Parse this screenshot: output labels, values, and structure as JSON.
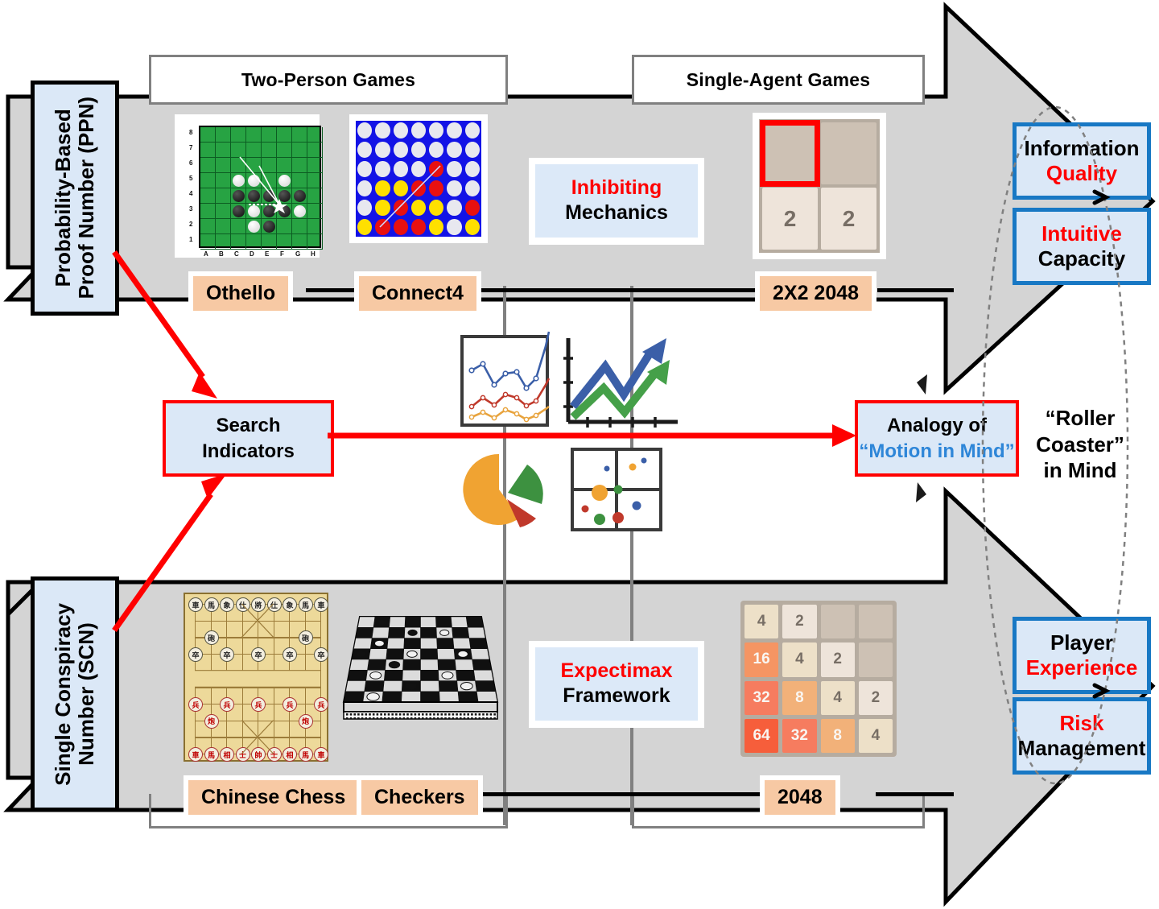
{
  "figure": {
    "categories": [
      {
        "label": "Two-Person Games"
      },
      {
        "label": "Single-Agent Games"
      }
    ],
    "left_labels": [
      {
        "label": "Probability-Based\nProof Number (PPN)"
      },
      {
        "label": "Single Conspiracy\nNumber (SCN)"
      }
    ],
    "game_chips_top": [
      {
        "label": "Othello"
      },
      {
        "label": "Connect4"
      },
      {
        "label": "2X2 2048"
      }
    ],
    "game_chips_bottom": [
      {
        "label": "Chinese Chess"
      },
      {
        "label": "Checkers"
      },
      {
        "label": "2048"
      }
    ],
    "concept_boxes": [
      {
        "line1": "Inhibiting",
        "line2": "Mechanics",
        "line1_color": "#ff0000",
        "line2_color": "#000000"
      },
      {
        "line1": "Expectimax",
        "line2": "Framework",
        "line1_color": "#ff0000",
        "line2_color": "#000000"
      }
    ],
    "search_indicators": {
      "line1": "Search",
      "line2": "Indicators"
    },
    "analogy": {
      "line1": "Analogy of",
      "line2": "“Motion in Mind”",
      "line2_color": "#2e86d8"
    },
    "roller_coaster": {
      "line1": "“Roller",
      "line2": "Coaster”",
      "line3": "in Mind"
    },
    "outcome_boxes": [
      {
        "line1": "Information",
        "line2": "Quality",
        "line1_color": "#000000",
        "line2_color": "#ff0000"
      },
      {
        "line1": "Intuitive",
        "line2": "Capacity",
        "line1_color": "#ff0000",
        "line2_color": "#000000"
      },
      {
        "line1": "Player",
        "line2": "Experience",
        "line1_color": "#000000",
        "line2_color": "#ff0000"
      },
      {
        "line1": "Risk",
        "line2": "Management",
        "line1_color": "#ff0000",
        "line2_color": "#000000"
      }
    ],
    "othello": {
      "col_labels": [
        "A",
        "B",
        "C",
        "D",
        "E",
        "F",
        "G",
        "H"
      ],
      "row_labels": [
        "8",
        "7",
        "6",
        "5",
        "4",
        "3",
        "2",
        "1"
      ],
      "white": [
        [
          2,
          5
        ],
        [
          3,
          5
        ],
        [
          5,
          5
        ],
        [
          3,
          3
        ],
        [
          6,
          3
        ],
        [
          3,
          2
        ]
      ],
      "black": [
        [
          2,
          4
        ],
        [
          3,
          4
        ],
        [
          4,
          4
        ],
        [
          5,
          4
        ],
        [
          6,
          4
        ],
        [
          2,
          3
        ],
        [
          4,
          3
        ],
        [
          5,
          3
        ],
        [
          4,
          2
        ]
      ]
    },
    "connect4": {
      "rows": 6,
      "cols": 7,
      "grid": [
        [
          "e",
          "e",
          "e",
          "e",
          "e",
          "e",
          "e"
        ],
        [
          "e",
          "e",
          "e",
          "e",
          "e",
          "e",
          "e"
        ],
        [
          "e",
          "e",
          "e",
          "e",
          "r",
          "e",
          "e"
        ],
        [
          "e",
          "y",
          "y",
          "r",
          "r",
          "e",
          "e"
        ],
        [
          "e",
          "y",
          "r",
          "y",
          "y",
          "e",
          "r"
        ],
        [
          "y",
          "r",
          "r",
          "r",
          "y",
          "e",
          "y"
        ]
      ]
    },
    "board2x2": {
      "cells": [
        "",
        "",
        "2",
        "2"
      ],
      "highlight_index": 0
    },
    "board2048": {
      "grid": [
        [
          "4",
          "2",
          "",
          ""
        ],
        [
          "16",
          "4",
          "2",
          ""
        ],
        [
          "32",
          "8",
          "4",
          "2"
        ],
        [
          "64",
          "32",
          "8",
          "4"
        ]
      ]
    },
    "tile_colors": {
      "2": {
        "bg": "#eee4da",
        "fg": "#776e65"
      },
      "4": {
        "bg": "#ede0c8",
        "fg": "#776e65"
      },
      "8": {
        "bg": "#f2b179",
        "fg": "#f9f6f2"
      },
      "16": {
        "bg": "#f59563",
        "fg": "#f9f6f2"
      },
      "32": {
        "bg": "#f67c5f",
        "fg": "#f9f6f2"
      },
      "64": {
        "bg": "#f65e3b",
        "fg": "#f9f6f2"
      },
      "": {
        "bg": "#cdc1b4",
        "fg": "#cdc1b4"
      }
    },
    "chinese_chess": {
      "black_back": [
        "車",
        "馬",
        "象",
        "仕",
        "將",
        "仕",
        "象",
        "馬",
        "車"
      ],
      "black_cannon": [
        "砲",
        "砲"
      ],
      "black_pawn": [
        "卒",
        "卒",
        "卒",
        "卒",
        "卒"
      ],
      "red_pawn": [
        "兵",
        "兵",
        "兵",
        "兵",
        "兵"
      ],
      "red_cannon": [
        "炮",
        "炮"
      ],
      "red_back": [
        "車",
        "馬",
        "相",
        "士",
        "帥",
        "士",
        "相",
        "馬",
        "車"
      ]
    },
    "colors": {
      "gray_arrow": "#d4d4d4",
      "chip": "#f7c9a4",
      "light_blue": "#dbe8f7",
      "blue_border": "#1878c4",
      "red": "#ff0000",
      "accent_blue": "#2e86d8"
    },
    "chart_icons": [
      {
        "name": "line-chart-icon",
        "series_colors": [
          "#3b5fa8",
          "#c0392b",
          "#e8a33d"
        ]
      },
      {
        "name": "growth-arrows-icon",
        "series_colors": [
          "#3b5fa8",
          "#45a049"
        ]
      },
      {
        "name": "pie-chart-icon",
        "slices": [
          72,
          18,
          10
        ],
        "slice_colors": [
          "#f0a332",
          "#3d9140",
          "#c0392b"
        ]
      },
      {
        "name": "bubble-quadrant-icon",
        "bubble_colors": [
          "#f0a332",
          "#3d9140",
          "#c0392b",
          "#3b5fa8"
        ]
      }
    ]
  }
}
